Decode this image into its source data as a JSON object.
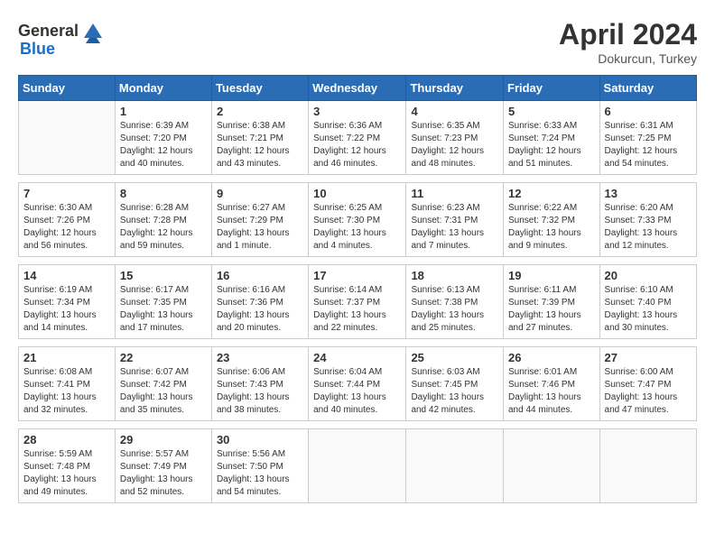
{
  "header": {
    "logo_general": "General",
    "logo_blue": "Blue",
    "month_year": "April 2024",
    "location": "Dokurcun, Turkey"
  },
  "weekdays": [
    "Sunday",
    "Monday",
    "Tuesday",
    "Wednesday",
    "Thursday",
    "Friday",
    "Saturday"
  ],
  "weeks": [
    [
      {
        "day": "",
        "info": ""
      },
      {
        "day": "1",
        "info": "Sunrise: 6:39 AM\nSunset: 7:20 PM\nDaylight: 12 hours\nand 40 minutes."
      },
      {
        "day": "2",
        "info": "Sunrise: 6:38 AM\nSunset: 7:21 PM\nDaylight: 12 hours\nand 43 minutes."
      },
      {
        "day": "3",
        "info": "Sunrise: 6:36 AM\nSunset: 7:22 PM\nDaylight: 12 hours\nand 46 minutes."
      },
      {
        "day": "4",
        "info": "Sunrise: 6:35 AM\nSunset: 7:23 PM\nDaylight: 12 hours\nand 48 minutes."
      },
      {
        "day": "5",
        "info": "Sunrise: 6:33 AM\nSunset: 7:24 PM\nDaylight: 12 hours\nand 51 minutes."
      },
      {
        "day": "6",
        "info": "Sunrise: 6:31 AM\nSunset: 7:25 PM\nDaylight: 12 hours\nand 54 minutes."
      }
    ],
    [
      {
        "day": "7",
        "info": "Sunrise: 6:30 AM\nSunset: 7:26 PM\nDaylight: 12 hours\nand 56 minutes."
      },
      {
        "day": "8",
        "info": "Sunrise: 6:28 AM\nSunset: 7:28 PM\nDaylight: 12 hours\nand 59 minutes."
      },
      {
        "day": "9",
        "info": "Sunrise: 6:27 AM\nSunset: 7:29 PM\nDaylight: 13 hours\nand 1 minute."
      },
      {
        "day": "10",
        "info": "Sunrise: 6:25 AM\nSunset: 7:30 PM\nDaylight: 13 hours\nand 4 minutes."
      },
      {
        "day": "11",
        "info": "Sunrise: 6:23 AM\nSunset: 7:31 PM\nDaylight: 13 hours\nand 7 minutes."
      },
      {
        "day": "12",
        "info": "Sunrise: 6:22 AM\nSunset: 7:32 PM\nDaylight: 13 hours\nand 9 minutes."
      },
      {
        "day": "13",
        "info": "Sunrise: 6:20 AM\nSunset: 7:33 PM\nDaylight: 13 hours\nand 12 minutes."
      }
    ],
    [
      {
        "day": "14",
        "info": "Sunrise: 6:19 AM\nSunset: 7:34 PM\nDaylight: 13 hours\nand 14 minutes."
      },
      {
        "day": "15",
        "info": "Sunrise: 6:17 AM\nSunset: 7:35 PM\nDaylight: 13 hours\nand 17 minutes."
      },
      {
        "day": "16",
        "info": "Sunrise: 6:16 AM\nSunset: 7:36 PM\nDaylight: 13 hours\nand 20 minutes."
      },
      {
        "day": "17",
        "info": "Sunrise: 6:14 AM\nSunset: 7:37 PM\nDaylight: 13 hours\nand 22 minutes."
      },
      {
        "day": "18",
        "info": "Sunrise: 6:13 AM\nSunset: 7:38 PM\nDaylight: 13 hours\nand 25 minutes."
      },
      {
        "day": "19",
        "info": "Sunrise: 6:11 AM\nSunset: 7:39 PM\nDaylight: 13 hours\nand 27 minutes."
      },
      {
        "day": "20",
        "info": "Sunrise: 6:10 AM\nSunset: 7:40 PM\nDaylight: 13 hours\nand 30 minutes."
      }
    ],
    [
      {
        "day": "21",
        "info": "Sunrise: 6:08 AM\nSunset: 7:41 PM\nDaylight: 13 hours\nand 32 minutes."
      },
      {
        "day": "22",
        "info": "Sunrise: 6:07 AM\nSunset: 7:42 PM\nDaylight: 13 hours\nand 35 minutes."
      },
      {
        "day": "23",
        "info": "Sunrise: 6:06 AM\nSunset: 7:43 PM\nDaylight: 13 hours\nand 38 minutes."
      },
      {
        "day": "24",
        "info": "Sunrise: 6:04 AM\nSunset: 7:44 PM\nDaylight: 13 hours\nand 40 minutes."
      },
      {
        "day": "25",
        "info": "Sunrise: 6:03 AM\nSunset: 7:45 PM\nDaylight: 13 hours\nand 42 minutes."
      },
      {
        "day": "26",
        "info": "Sunrise: 6:01 AM\nSunset: 7:46 PM\nDaylight: 13 hours\nand 44 minutes."
      },
      {
        "day": "27",
        "info": "Sunrise: 6:00 AM\nSunset: 7:47 PM\nDaylight: 13 hours\nand 47 minutes."
      }
    ],
    [
      {
        "day": "28",
        "info": "Sunrise: 5:59 AM\nSunset: 7:48 PM\nDaylight: 13 hours\nand 49 minutes."
      },
      {
        "day": "29",
        "info": "Sunrise: 5:57 AM\nSunset: 7:49 PM\nDaylight: 13 hours\nand 52 minutes."
      },
      {
        "day": "30",
        "info": "Sunrise: 5:56 AM\nSunset: 7:50 PM\nDaylight: 13 hours\nand 54 minutes."
      },
      {
        "day": "",
        "info": ""
      },
      {
        "day": "",
        "info": ""
      },
      {
        "day": "",
        "info": ""
      },
      {
        "day": "",
        "info": ""
      }
    ]
  ]
}
